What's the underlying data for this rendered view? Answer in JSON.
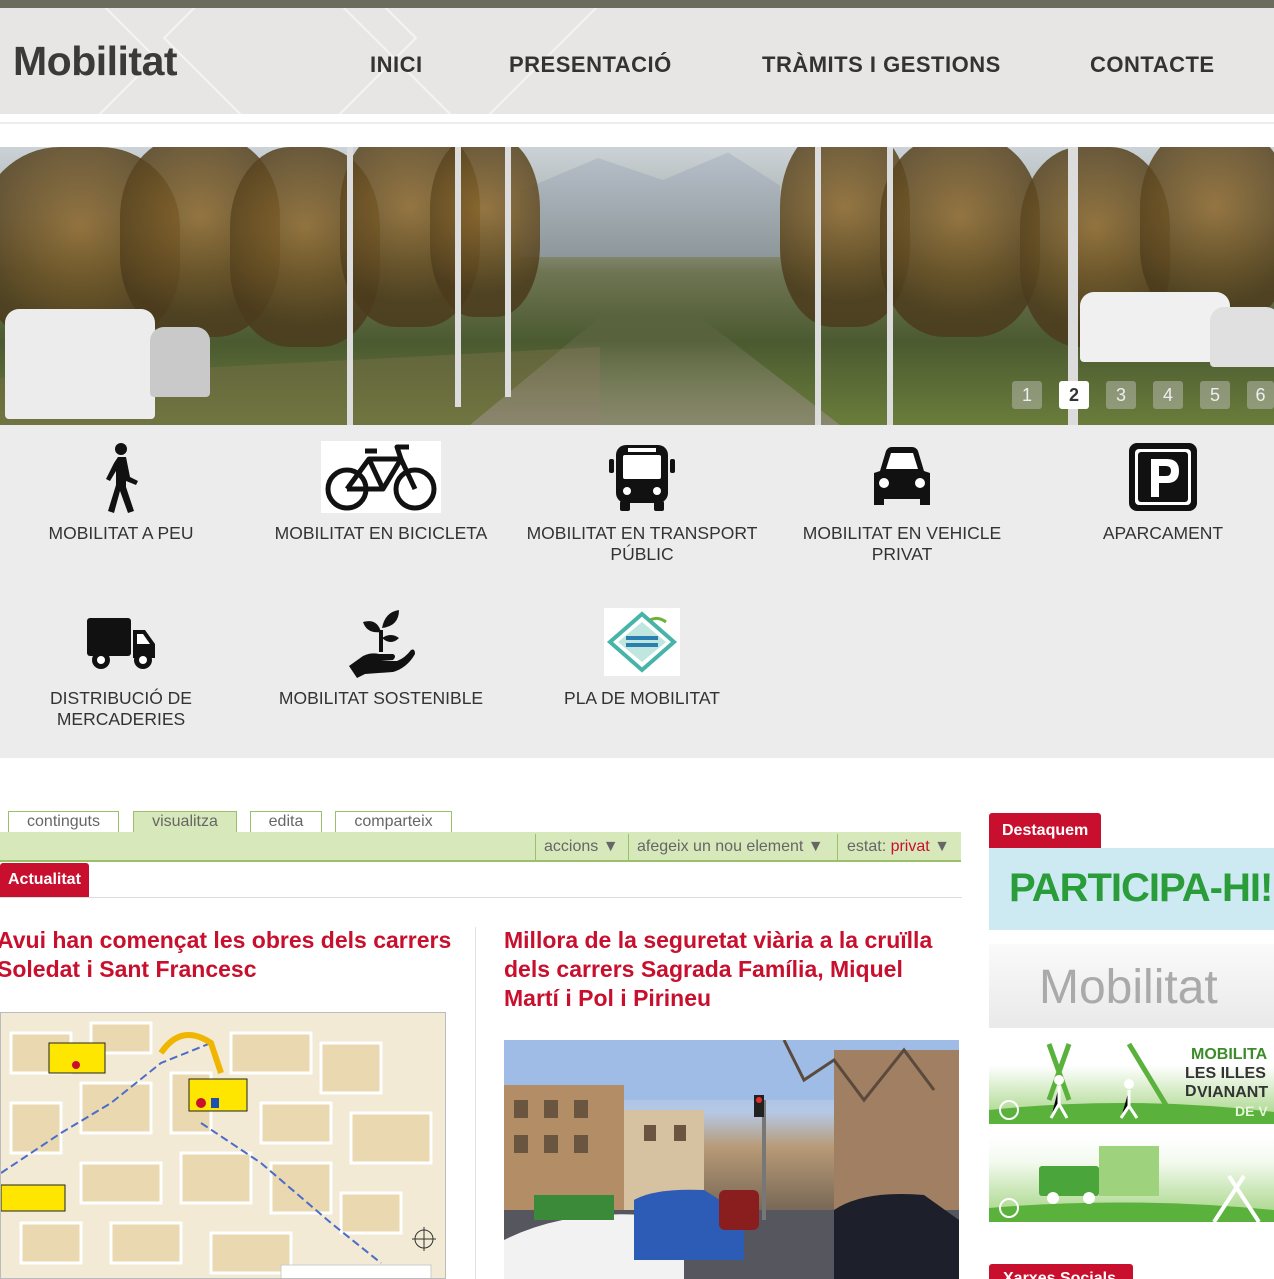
{
  "header": {
    "logo": "Mobilitat",
    "nav": [
      "INICI",
      "PRESENTACIÓ",
      "TRÀMITS I GESTIONS",
      "CONTACTE"
    ]
  },
  "slider": {
    "pages": [
      "1",
      "2",
      "3",
      "4",
      "5",
      "6"
    ],
    "active": "2"
  },
  "categories": [
    {
      "label": "MOBILITAT A PEU",
      "icon": "walking-person-icon"
    },
    {
      "label": "MOBILITAT EN BICICLETA",
      "icon": "bicycle-icon"
    },
    {
      "label": "MOBILITAT EN TRANSPORT PÚBLIC",
      "icon": "bus-icon"
    },
    {
      "label": "MOBILITAT EN VEHICLE PRIVAT",
      "icon": "car-icon"
    },
    {
      "label": "APARCAMENT",
      "icon": "parking-icon"
    },
    {
      "label": "DISTRIBUCIÓ DE MERCADERIES",
      "icon": "truck-icon"
    },
    {
      "label": "MOBILITAT SOSTENIBLE",
      "icon": "plant-hand-icon"
    },
    {
      "label": "PLA DE MOBILITAT",
      "icon": "pla-de-mobilitat-logo"
    }
  ],
  "cms": {
    "tabs": [
      "continguts",
      "visualitza",
      "edita",
      "comparteix"
    ],
    "active_tab": "visualitza",
    "actions": "accions ▼",
    "add": "afegeix un nou element ▼",
    "state_label": "estat: ",
    "state_value": "privat",
    "state_arrow": " ▼"
  },
  "news": {
    "section": "Actualitat",
    "items": [
      {
        "title": "Avui han començat les obres dels carrers Soledat i Sant Francesc"
      },
      {
        "title": "Millora de la seguretat viària a la cruïlla dels carrers Sagrada Família, Miquel Martí i Pol i Pirineu"
      }
    ]
  },
  "sidebar": {
    "featured": "Destaquem",
    "banners": [
      "PARTICIPA-HI!",
      "Mobilitat"
    ],
    "banner3_lines": [
      "MOBILITA",
      "LES ILLES D",
      "VIANANT",
      "DE V"
    ],
    "social": "Xarxes Socials"
  },
  "colors": {
    "accent": "#c8102e",
    "cms_green": "#d7e9ba",
    "cms_border": "#9bc06a",
    "participa": "#2a9d3a"
  }
}
